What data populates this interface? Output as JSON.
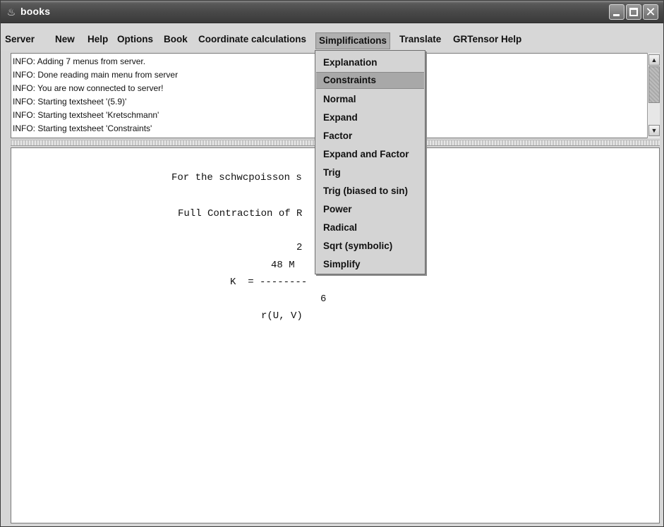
{
  "window": {
    "title": "books"
  },
  "menubar": {
    "items": [
      {
        "label": "Server"
      },
      {
        "label": "New"
      },
      {
        "label": "Help"
      },
      {
        "label": "Options"
      },
      {
        "label": "Book"
      },
      {
        "label": "Coordinate calculations"
      },
      {
        "label": "Simplifications"
      },
      {
        "label": "Translate"
      },
      {
        "label": "GRTensor Help"
      }
    ],
    "active_menu": "Simplifications"
  },
  "log": {
    "lines": [
      "INFO: Adding 7 menus from server.",
      "INFO: Done reading main menu from server",
      "INFO: You are now connected to server!",
      "INFO: Starting textsheet '(5.9)'",
      "INFO: Starting textsheet 'Kretschmann'",
      "INFO: Starting textsheet 'Constraints'"
    ]
  },
  "worksheet": {
    "lines": [
      "For the schwcpoisson s",
      "Full Contraction of R",
      "2",
      "48 M",
      "K  = --------",
      "6",
      "r(U, V)"
    ]
  },
  "dropdown": {
    "items": [
      {
        "label": "Explanation"
      },
      {
        "label": "Constraints"
      },
      {
        "label": "Normal"
      },
      {
        "label": "Expand"
      },
      {
        "label": "Factor"
      },
      {
        "label": "Expand and Factor"
      },
      {
        "label": "Trig"
      },
      {
        "label": "Trig (biased to sin)"
      },
      {
        "label": "Power"
      },
      {
        "label": "Radical"
      },
      {
        "label": "Sqrt (symbolic)"
      },
      {
        "label": "Simplify"
      }
    ],
    "highlighted": "Constraints"
  },
  "icons": {
    "app": "java-cup-icon",
    "minimize": "minimize-icon",
    "maximize": "maximize-icon",
    "close": "close-icon",
    "scroll_up": "arrow-up-icon",
    "scroll_down": "arrow-down-icon"
  }
}
